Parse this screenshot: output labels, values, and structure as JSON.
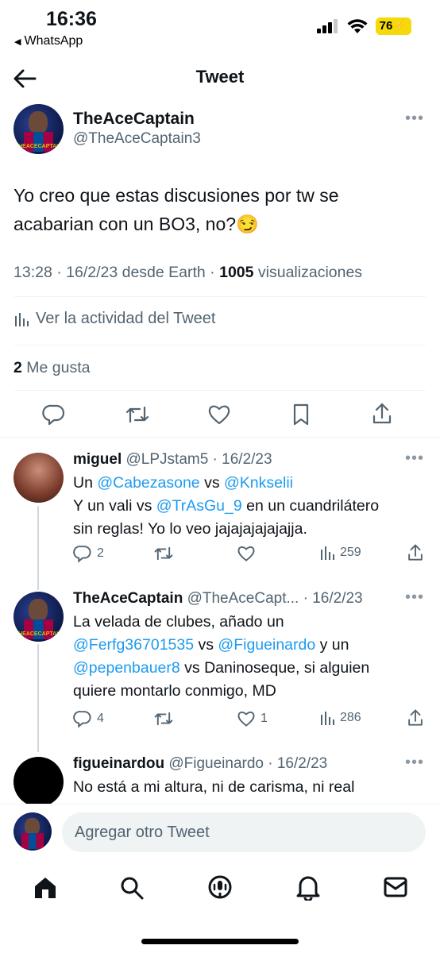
{
  "status": {
    "time": "16:36",
    "back_app": "WhatsApp",
    "battery": "76"
  },
  "nav": {
    "title": "Tweet"
  },
  "tweet": {
    "name": "TheAceCaptain",
    "handle": "@TheAceCaptain3",
    "avatar_text": "THEACECAPTAIN",
    "text_line1": "Yo creo que estas discusiones por tw se",
    "text_line2": "acabarian con un BO3, no?😏",
    "meta_time": "13:28 · 16/2/23 desde Earth ·",
    "meta_views_count": "1005",
    "meta_views_label": "visualizaciones",
    "activity": "Ver la actividad del Tweet",
    "likes_count": "2",
    "likes_label": "Me gusta"
  },
  "replies": [
    {
      "name": "miguel",
      "meta": "@LPJstam5 · 16/2/23",
      "line1_prefix": "Un ",
      "line1_mention1": "@Cabezasone",
      "line1_mid": "  vs ",
      "line1_mention2": "@Knkselii",
      "line2_prefix": "Y un vali vs ",
      "line2_mention": "@TrAsGu_9",
      "line2_suffix": "  en un cuandrilátero",
      "line3": "sin reglas! Yo lo veo jajajajajajajja.",
      "replies": "2",
      "retweets": "",
      "likes": "",
      "views": "259"
    },
    {
      "name": "TheAceCaptain",
      "meta": "@TheAceCapt... · 16/2/23",
      "line1": "La velada de clubes, añado un",
      "line2_mention1": "@Ferfg36701535",
      "line2_mid": " vs ",
      "line2_mention2": "@Figueinardo",
      "line2_suffix": " y un",
      "line3_mention": "@pepenbauer8",
      "line3_suffix": " vs Daninoseque, si alguien",
      "line4": "quiere montarlo conmigo, MD",
      "replies": "4",
      "retweets": "",
      "likes": "1",
      "views": "286"
    },
    {
      "name": "figueinardou",
      "meta": "@Figueinardo · 16/2/23",
      "line1": "No está a mi altura, ni de carisma, ni real"
    }
  ],
  "compose": {
    "placeholder": "Agregar otro Tweet"
  },
  "colors": {
    "accent": "#1d9bf0",
    "muted": "#536471",
    "battery": "#f5d90a"
  }
}
